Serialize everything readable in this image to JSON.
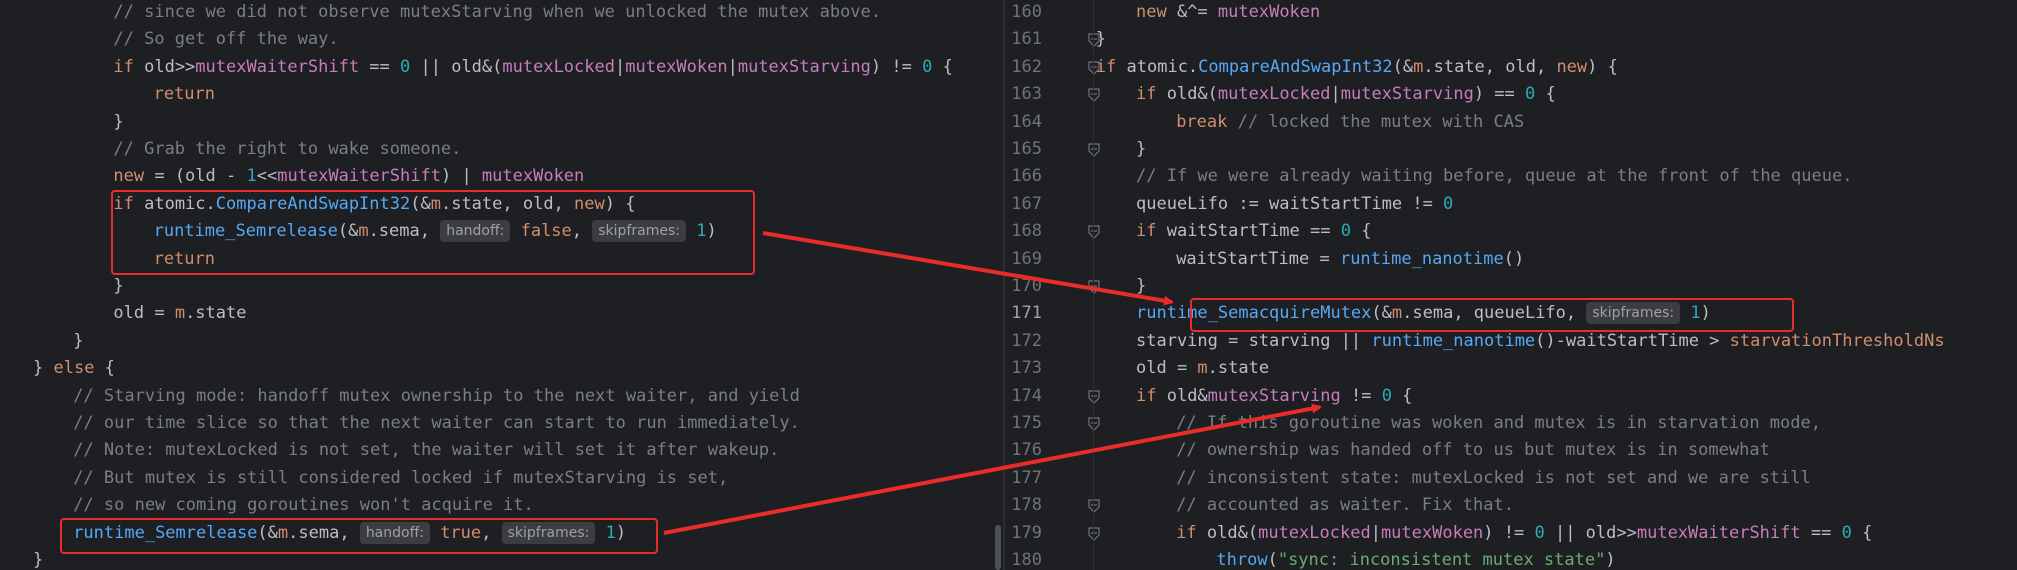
{
  "left": {
    "lines": [
      {
        "indent": 8,
        "segs": [
          [
            "cm",
            "// since we did not observe mutexStarving when we unlocked the mutex above."
          ]
        ]
      },
      {
        "indent": 8,
        "segs": [
          [
            "cm",
            "// So get off the way."
          ]
        ]
      },
      {
        "indent": 8,
        "segs": [
          [
            "kw",
            "if "
          ],
          [
            "pl",
            "old>>"
          ],
          [
            "cn",
            "mutexWaiterShift"
          ],
          [
            "pl",
            " == "
          ],
          [
            "num",
            "0"
          ],
          [
            "pl",
            " || old&("
          ],
          [
            "cn",
            "mutexLocked"
          ],
          [
            "pl",
            "|"
          ],
          [
            "cn",
            "mutexWoken"
          ],
          [
            "pl",
            "|"
          ],
          [
            "cn",
            "mutexStarving"
          ],
          [
            "pl",
            ") != "
          ],
          [
            "num",
            "0"
          ],
          [
            "pl",
            " {"
          ]
        ]
      },
      {
        "indent": 12,
        "segs": [
          [
            "kw",
            "return"
          ]
        ]
      },
      {
        "indent": 8,
        "segs": [
          [
            "pl",
            "}"
          ]
        ]
      },
      {
        "indent": 8,
        "segs": [
          [
            "cm",
            "// Grab the right to wake someone."
          ]
        ]
      },
      {
        "indent": 8,
        "segs": [
          [
            "kw",
            "new"
          ],
          [
            "pl",
            " = (old - "
          ],
          [
            "num",
            "1"
          ],
          [
            "pl",
            "<<"
          ],
          [
            "cn",
            "mutexWaiterShift"
          ],
          [
            "pl",
            ") | "
          ],
          [
            "cn",
            "mutexWoken"
          ]
        ]
      },
      {
        "indent": 8,
        "segs": [
          [
            "kw",
            "if "
          ],
          [
            "pl",
            "atomic."
          ],
          [
            "fn",
            "CompareAndSwapInt32"
          ],
          [
            "pl",
            "(&"
          ],
          [
            "kw",
            "m"
          ],
          [
            "pl",
            ".state, old, "
          ],
          [
            "kw",
            "new"
          ],
          [
            "pl",
            ") {"
          ]
        ]
      },
      {
        "indent": 12,
        "segs": [
          [
            "fn",
            "runtime_Semrelease"
          ],
          [
            "pl",
            "(&"
          ],
          [
            "kw",
            "m"
          ],
          [
            "pl",
            ".sema, "
          ],
          [
            "hint",
            "handoff:"
          ],
          [
            "kw",
            " false"
          ],
          [
            "pl",
            ", "
          ],
          [
            "hint",
            "skipframes:"
          ],
          [
            "pl",
            " "
          ],
          [
            "num",
            "1"
          ],
          [
            "pl",
            ")"
          ]
        ]
      },
      {
        "indent": 12,
        "segs": [
          [
            "kw",
            "return"
          ]
        ]
      },
      {
        "indent": 8,
        "segs": [
          [
            "pl",
            "}"
          ]
        ]
      },
      {
        "indent": 8,
        "segs": [
          [
            "pl",
            "old = "
          ],
          [
            "kw",
            "m"
          ],
          [
            "pl",
            ".state"
          ]
        ]
      },
      {
        "indent": 4,
        "segs": [
          [
            "pl",
            "}"
          ]
        ]
      },
      {
        "indent": 0,
        "segs": [
          [
            "pl",
            "} "
          ],
          [
            "kw",
            "else"
          ],
          [
            "pl",
            " {"
          ]
        ]
      },
      {
        "indent": 4,
        "segs": [
          [
            "cm",
            "// Starving mode: handoff mutex ownership to the next waiter, and yield"
          ]
        ]
      },
      {
        "indent": 4,
        "segs": [
          [
            "cm",
            "// our time slice so that the next waiter can start to run immediately."
          ]
        ]
      },
      {
        "indent": 4,
        "segs": [
          [
            "cm",
            "// Note: mutexLocked is not set, the waiter will set it after wakeup."
          ]
        ]
      },
      {
        "indent": 4,
        "segs": [
          [
            "cm",
            "// But mutex is still considered locked if mutexStarving is set,"
          ]
        ]
      },
      {
        "indent": 4,
        "segs": [
          [
            "cm",
            "// so new coming goroutines won't acquire it."
          ]
        ]
      },
      {
        "indent": 4,
        "segs": [
          [
            "fn",
            "runtime_Semrelease"
          ],
          [
            "pl",
            "(&"
          ],
          [
            "kw",
            "m"
          ],
          [
            "pl",
            ".sema, "
          ],
          [
            "hint",
            "handoff:"
          ],
          [
            "kw",
            " true"
          ],
          [
            "pl",
            ", "
          ],
          [
            "hint",
            "skipframes:"
          ],
          [
            "pl",
            " "
          ],
          [
            "num",
            "1"
          ],
          [
            "pl",
            ")"
          ]
        ]
      },
      {
        "indent": 0,
        "segs": [
          [
            "pl",
            "}"
          ]
        ]
      }
    ]
  },
  "right": {
    "lines": [
      {
        "n": "160",
        "indent": 8,
        "segs": [
          [
            "kw",
            "new"
          ],
          [
            "pl",
            " &^= "
          ],
          [
            "cn",
            "mutexWoken"
          ]
        ]
      },
      {
        "n": "161",
        "indent": 4,
        "segs": [
          [
            "pl",
            "}"
          ]
        ]
      },
      {
        "n": "162",
        "indent": 4,
        "segs": [
          [
            "kw",
            "if "
          ],
          [
            "pl",
            "atomic."
          ],
          [
            "fn",
            "CompareAndSwapInt32"
          ],
          [
            "pl",
            "(&"
          ],
          [
            "kw",
            "m"
          ],
          [
            "pl",
            ".state, old, "
          ],
          [
            "kw",
            "new"
          ],
          [
            "pl",
            ") {"
          ]
        ]
      },
      {
        "n": "163",
        "indent": 8,
        "segs": [
          [
            "kw",
            "if "
          ],
          [
            "pl",
            "old&("
          ],
          [
            "cn",
            "mutexLocked"
          ],
          [
            "pl",
            "|"
          ],
          [
            "cn",
            "mutexStarving"
          ],
          [
            "pl",
            ") == "
          ],
          [
            "num",
            "0"
          ],
          [
            "pl",
            " {"
          ]
        ]
      },
      {
        "n": "164",
        "indent": 12,
        "segs": [
          [
            "kw",
            "break"
          ],
          [
            "cm",
            " // locked the mutex with CAS"
          ]
        ]
      },
      {
        "n": "165",
        "indent": 8,
        "segs": [
          [
            "pl",
            "}"
          ]
        ]
      },
      {
        "n": "166",
        "indent": 8,
        "segs": [
          [
            "cm",
            "// If we were already waiting before, queue at the front of the queue."
          ]
        ]
      },
      {
        "n": "167",
        "indent": 8,
        "segs": [
          [
            "pl",
            "queueLifo := waitStartTime != "
          ],
          [
            "num",
            "0"
          ]
        ]
      },
      {
        "n": "168",
        "indent": 8,
        "segs": [
          [
            "kw",
            "if "
          ],
          [
            "pl",
            "waitStartTime == "
          ],
          [
            "num",
            "0"
          ],
          [
            "pl",
            " {"
          ]
        ]
      },
      {
        "n": "169",
        "indent": 12,
        "segs": [
          [
            "pl",
            "waitStartTime = "
          ],
          [
            "fn",
            "runtime_nanotime"
          ],
          [
            "pl",
            "()"
          ]
        ]
      },
      {
        "n": "170",
        "indent": 8,
        "segs": [
          [
            "pl",
            "}"
          ]
        ]
      },
      {
        "n": "171",
        "indent": 8,
        "segs": [
          [
            "fn",
            "runtime_SemacquireMutex"
          ],
          [
            "pl",
            "(&"
          ],
          [
            "kw",
            "m"
          ],
          [
            "pl",
            ".sema, queueLifo, "
          ],
          [
            "hint",
            "skipframes:"
          ],
          [
            "pl",
            " "
          ],
          [
            "num",
            "1"
          ],
          [
            "pl",
            ")"
          ]
        ]
      },
      {
        "n": "172",
        "indent": 8,
        "segs": [
          [
            "pl",
            "starving = starving || "
          ],
          [
            "fn",
            "runtime_nanotime"
          ],
          [
            "pl",
            "()-waitStartTime > "
          ],
          [
            "kw",
            "starvationThresholdNs"
          ]
        ]
      },
      {
        "n": "173",
        "indent": 8,
        "segs": [
          [
            "pl",
            "old = "
          ],
          [
            "kw",
            "m"
          ],
          [
            "pl",
            ".state"
          ]
        ]
      },
      {
        "n": "174",
        "indent": 8,
        "segs": [
          [
            "kw",
            "if "
          ],
          [
            "pl",
            "old&"
          ],
          [
            "cn",
            "mutexStarving"
          ],
          [
            "pl",
            " != "
          ],
          [
            "num",
            "0"
          ],
          [
            "pl",
            " {"
          ]
        ]
      },
      {
        "n": "175",
        "indent": 12,
        "segs": [
          [
            "cm",
            "// If this goroutine was woken and mutex is in starvation mode,"
          ]
        ]
      },
      {
        "n": "176",
        "indent": 12,
        "segs": [
          [
            "cm",
            "// ownership was handed off to us but mutex is in somewhat"
          ]
        ]
      },
      {
        "n": "177",
        "indent": 12,
        "segs": [
          [
            "cm",
            "// inconsistent state: mutexLocked is not set and we are still"
          ]
        ]
      },
      {
        "n": "178",
        "indent": 12,
        "segs": [
          [
            "cm",
            "// accounted as waiter. Fix that."
          ]
        ]
      },
      {
        "n": "179",
        "indent": 12,
        "segs": [
          [
            "kw",
            "if "
          ],
          [
            "pl",
            "old&("
          ],
          [
            "cn",
            "mutexLocked"
          ],
          [
            "pl",
            "|"
          ],
          [
            "cn",
            "mutexWoken"
          ],
          [
            "pl",
            ") != "
          ],
          [
            "num",
            "0"
          ],
          [
            "pl",
            " || old>>"
          ],
          [
            "cn",
            "mutexWaiterShift"
          ],
          [
            "pl",
            " == "
          ],
          [
            "num",
            "0"
          ],
          [
            "pl",
            " {"
          ]
        ]
      },
      {
        "n": "180",
        "indent": 16,
        "segs": [
          [
            "fn",
            "throw"
          ],
          [
            "pl",
            "("
          ],
          [
            "str",
            "\"sync: inconsistent mutex state\""
          ],
          [
            "pl",
            ")"
          ]
        ]
      }
    ],
    "current_line": "171"
  },
  "colors": {
    "background": "#1e1f22",
    "keyword": "#cf8e6d",
    "function": "#56a8f5",
    "comment": "#7a7e85",
    "constant": "#c77dbb",
    "number": "#2aacb8",
    "annotation": "#ea2b2b"
  }
}
